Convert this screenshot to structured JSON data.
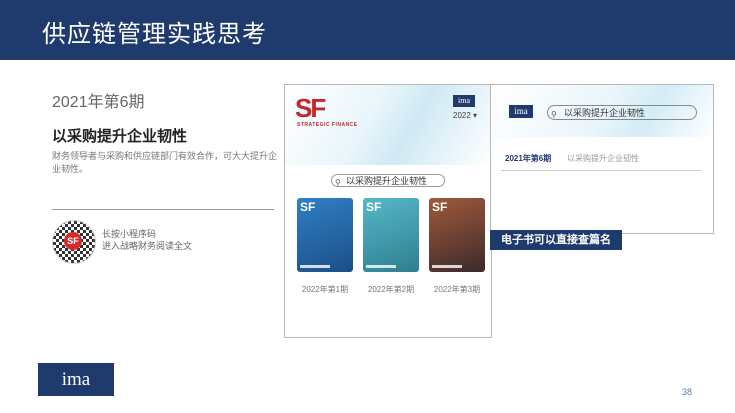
{
  "header": {
    "title": "供应链管理实践思考"
  },
  "left": {
    "issue": "2021年第6期",
    "headline": "以采购提升企业韧性",
    "description": "财务领导者与采购和供应链部门有效合作，可大大提升企业韧性。",
    "qr_badge": "SF",
    "qr_line1": "长按小程序码",
    "qr_line2": "进入战略财务阅读全文"
  },
  "phone1": {
    "logo": "SF",
    "logo_sub": "STRATEGIC FINANCE",
    "ima": "ima",
    "year": "2022 ▾",
    "search_text": "以采购提升企业韧性",
    "covers": [
      {
        "label": "2022年第1期",
        "color": "#2f7fc4"
      },
      {
        "label": "2022年第2期",
        "color": "#3a9ab0"
      },
      {
        "label": "2022年第3期",
        "color": "#7a4a3a"
      }
    ]
  },
  "phone2": {
    "ima": "ima",
    "search_text": "以采购提升企业韧性",
    "tab_active": "2021年第6期",
    "tab_inactive": "以采购提升企业韧性"
  },
  "caption": "电子书可以直接查篇名",
  "footer": {
    "logo": "ima",
    "page": "38"
  },
  "colors": {
    "brand": "#1f3a6d",
    "sf_red": "#c1272d"
  }
}
